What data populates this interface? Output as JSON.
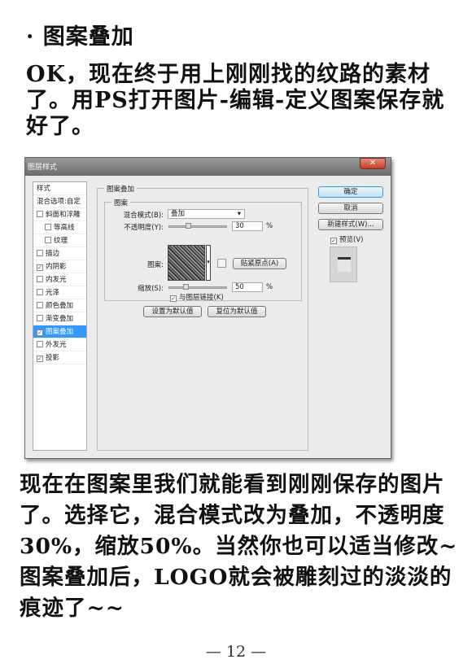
{
  "heading": "· 图案叠加",
  "para1": "OK，现在终于用上刚刚找的纹路的素材了。用PS打开图片-编辑-定义图案保存就好了。",
  "para2": "现在在图案里我们就能看到刚刚保存的图片了。选择它，混合模式改为叠加，不透明度30%，缩放50%。当然你也可以适当修改~图案叠加后，LOGO就会被雕刻过的淡淡的痕迹了~~",
  "footer": "— 12 —",
  "dialog": {
    "title": "图层样式",
    "close": "✕",
    "styles_header": "样式",
    "blend_options": "混合选项:自定",
    "items": [
      {
        "label": "斜面和浮雕",
        "checked": false
      },
      {
        "label": "等高线",
        "checked": false
      },
      {
        "label": "纹理",
        "checked": false
      },
      {
        "label": "描边",
        "checked": false
      },
      {
        "label": "内阴影",
        "checked": true
      },
      {
        "label": "内发光",
        "checked": false
      },
      {
        "label": "光泽",
        "checked": false
      },
      {
        "label": "颜色叠加",
        "checked": false
      },
      {
        "label": "渐变叠加",
        "checked": false
      },
      {
        "label": "图案叠加",
        "checked": true,
        "selected": true
      },
      {
        "label": "外发光",
        "checked": false
      },
      {
        "label": "投影",
        "checked": true
      }
    ],
    "section": "图案叠加",
    "group": "图案",
    "blend_mode_label": "混合模式(B):",
    "blend_mode": "叠加",
    "opacity_label": "不透明度(Y):",
    "opacity": "30",
    "pattern_label": "图案:",
    "snap_origin": "贴紧原点(A)",
    "scale_label": "缩放(S):",
    "scale": "50",
    "percent": "%",
    "link_layer": "与图层链接(K)",
    "link_checked": true,
    "make_default": "设置为默认值",
    "reset_default": "复位为默认值",
    "ok": "确定",
    "cancel": "取消",
    "new_style": "新建样式(W)...",
    "preview": "预览(V)",
    "preview_checked": true
  }
}
